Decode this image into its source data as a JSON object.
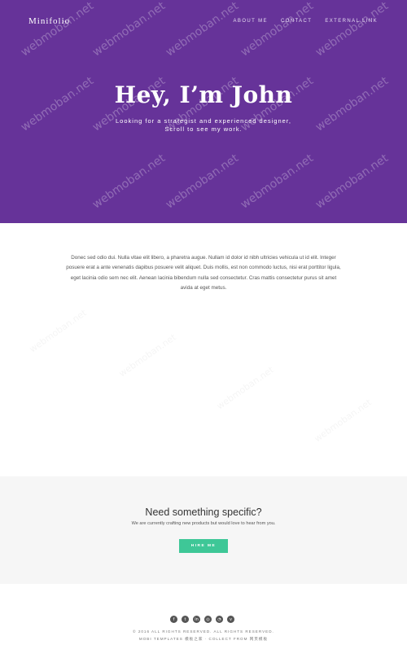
{
  "header": {
    "brand": "Minifolio",
    "nav": [
      "ABOUT ME",
      "CONTACT",
      "EXTERNAL LINK"
    ]
  },
  "hero": {
    "title": "Hey, I’m John",
    "subtitle_line1": "Looking for a strategist and experienced designer,",
    "subtitle_line2": "Scroll to see my work."
  },
  "intro": {
    "text": "Donec sed odio dui. Nulla vitae elit libero, a pharetra augue. Nullam id dolor id nibh ultricies vehicula ut id elit. Integer posuere erat a ante venenatis dapibus posuere velit aliquet. Duis mollis, est non commodo luctus, nisi erat porttitor ligula, eget lacinia odio sem nec elit. Aenean lacinia bibendum nulla sed consectetur. Cras mattis consectetur purus sit amet avida at eget metus."
  },
  "cta": {
    "title": "Need something specific?",
    "text": "We are currently crafting new products but would love to hear from you.",
    "button": "HIRE ME"
  },
  "footer": {
    "social_icons": [
      "facebook-icon",
      "twitter-icon",
      "linkedin-icon",
      "dribbble-icon",
      "rss-icon",
      "vimeo-icon"
    ],
    "copyright": "© 2016 ALL RIGHTS RESERVED. ALL RIGHTS RESERVED.",
    "credit": "MOBI TEMPLATES 模板之家 · COLLECT FROM 网页模板"
  },
  "watermark": "webmoban.net",
  "colors": {
    "hero_bg": "#663399",
    "button": "#3ec797",
    "cta_bg": "#f6f6f6"
  }
}
